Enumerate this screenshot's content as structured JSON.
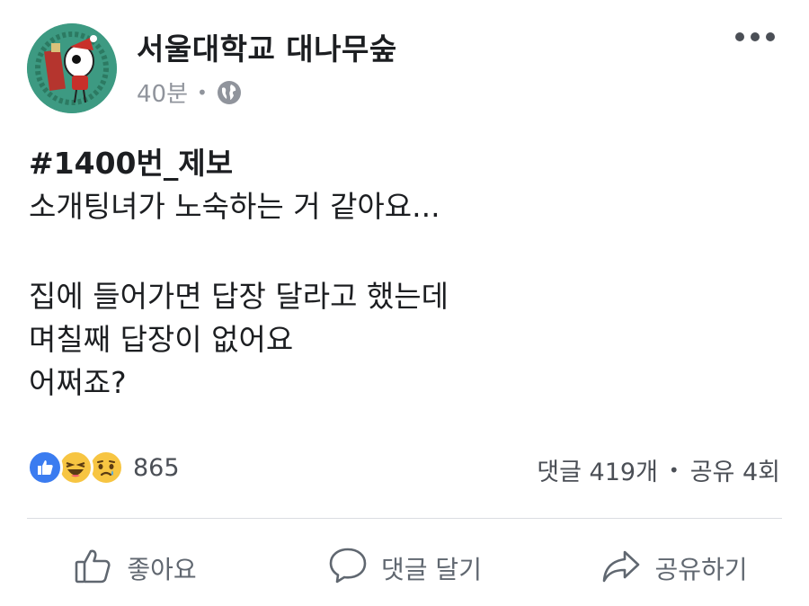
{
  "header": {
    "page_name": "서울대학교 대나무숲",
    "time": "40분",
    "separator": "•",
    "audience_icon": "globe-icon",
    "more_icon": "more-options-icon"
  },
  "post": {
    "hashtag": "#1400번_제보",
    "lines": [
      "소개팅녀가 노숙하는 거 같아요...",
      "",
      "집에 들어가면 답장 달라고 했는데",
      "며칠째 답장이 없어요",
      "어쩌죠?"
    ]
  },
  "reactions": {
    "icons": [
      "like-reaction-icon",
      "haha-reaction-icon",
      "sad-reaction-icon"
    ],
    "count": "865"
  },
  "stats": {
    "comments": "댓글 419개",
    "separator": "•",
    "shares": "공유 4회"
  },
  "actions": {
    "like_label": "좋아요",
    "comment_label": "댓글 달기",
    "share_label": "공유하기"
  },
  "colors": {
    "avatar_bg": "#3d9a82",
    "like_blue": "#3b7cf0",
    "emoji_yellow": "#f7c542",
    "secondary_text": "#90949c"
  }
}
